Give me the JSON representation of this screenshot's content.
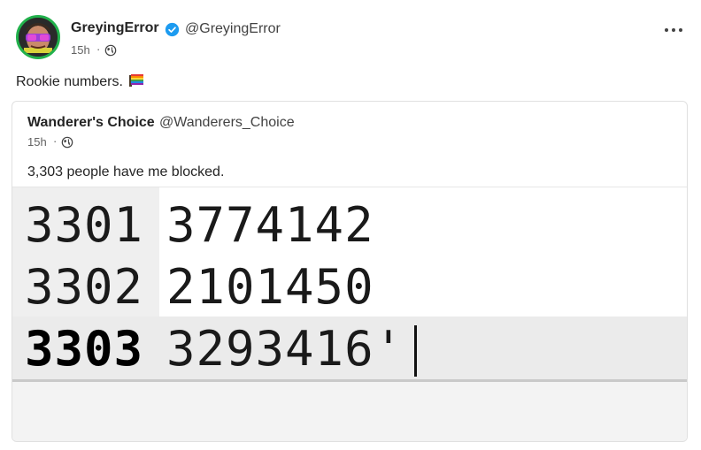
{
  "post": {
    "author_name": "GreyingError",
    "author_handle": "@GreyingError",
    "time": "15h",
    "separator": "·",
    "text": "Rookie numbers.",
    "verified": true,
    "menu_icon": "more-horizontal-icon",
    "visibility_icon": "globe-icon",
    "emoji_icon": "pride-flag-emoji-icon"
  },
  "quote": {
    "author_name": "Wanderer's Choice",
    "author_handle": "@Wanderers_Choice",
    "time": "15h",
    "separator": "·",
    "text": "3,303 people have me blocked.",
    "visibility_icon": "globe-icon",
    "image": {
      "rows": [
        {
          "key": "3301",
          "value": "3774142",
          "selected": false
        },
        {
          "key": "3302",
          "value": "2101450",
          "selected": false
        },
        {
          "key": "3303",
          "value": "3293416'",
          "selected": true
        }
      ]
    }
  },
  "colors": {
    "verified_blue": "#1d9bf0",
    "avatar_ring": "#22b14c"
  }
}
